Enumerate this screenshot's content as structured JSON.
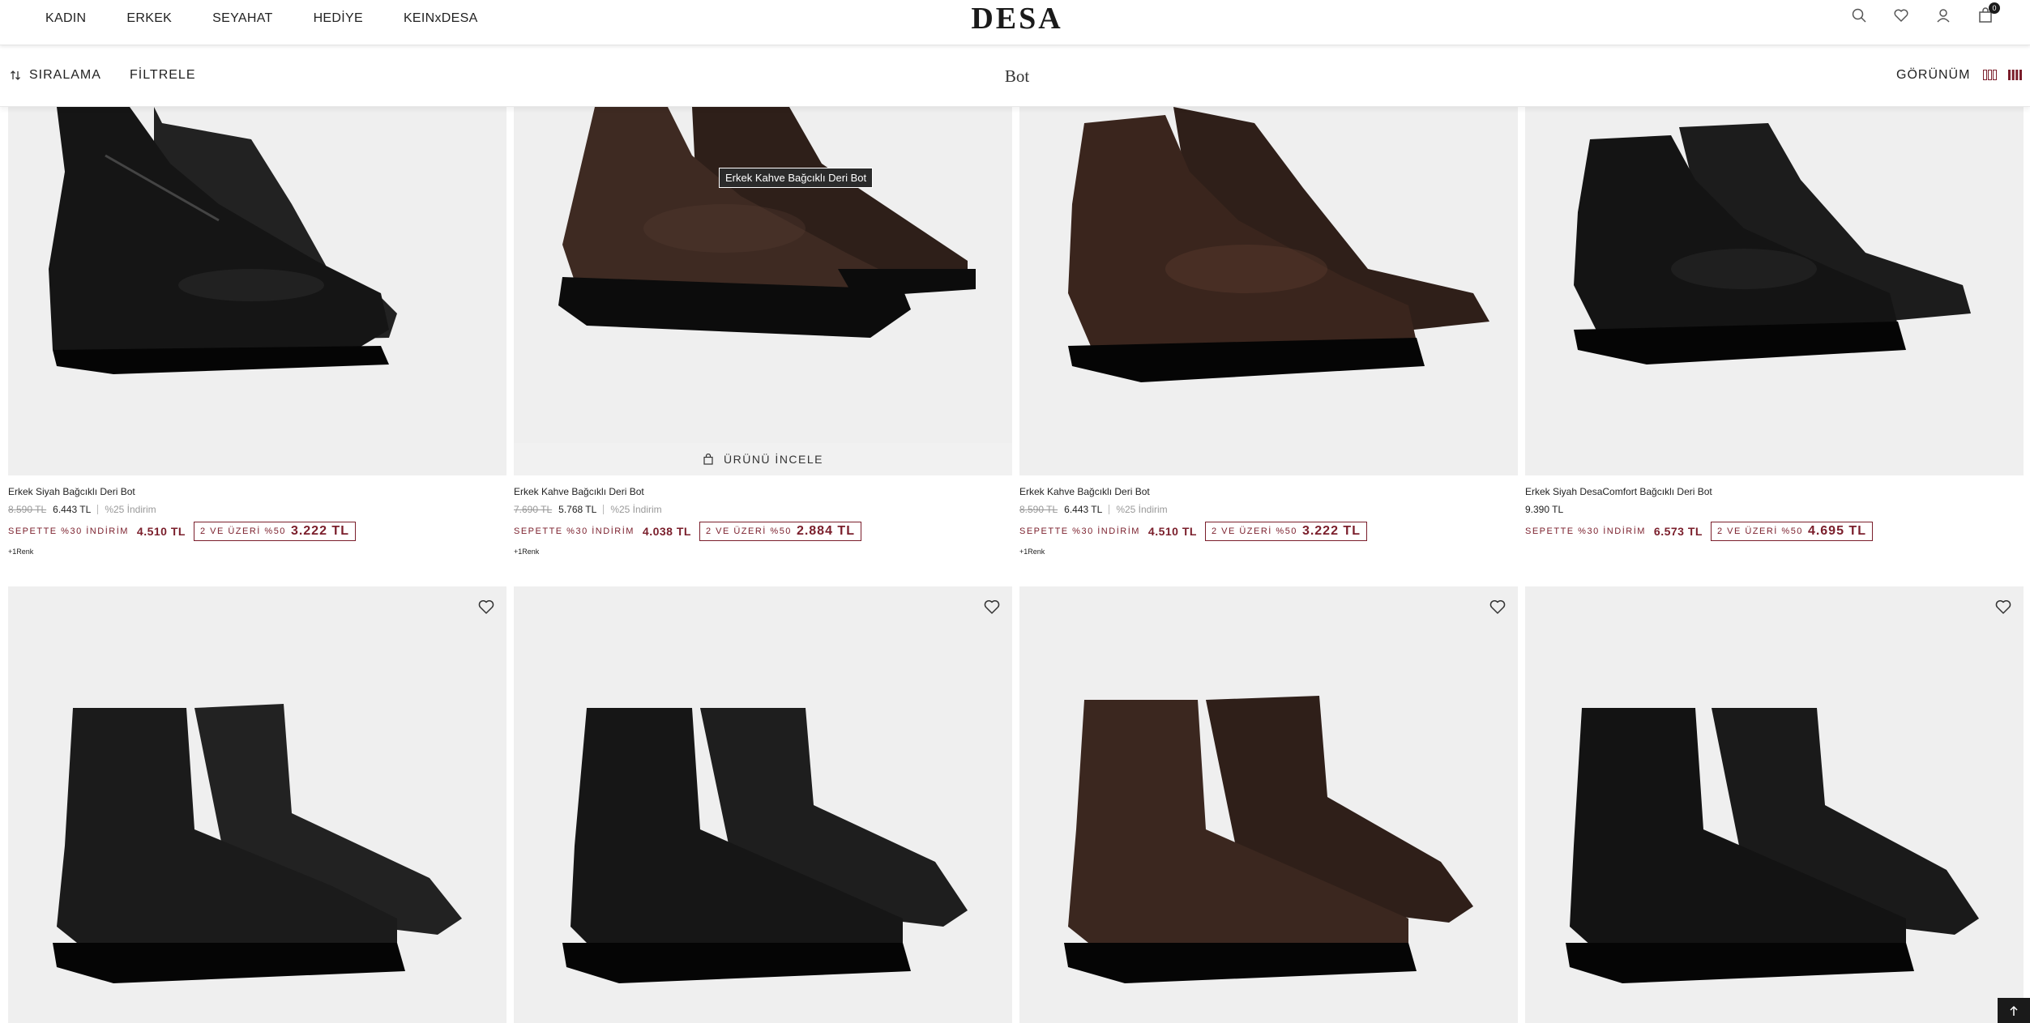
{
  "nav": {
    "links": [
      "KADIN",
      "ERKEK",
      "SEYAHAT",
      "HEDİYE",
      "KEINxDESA"
    ],
    "logo": "DESA",
    "icons": [
      "search-icon",
      "heart-icon",
      "user-icon",
      "bag-icon"
    ],
    "cart_count": "0"
  },
  "toolbar": {
    "sort_label": "SIRALAMA",
    "filter_label": "FİLTRELE",
    "page_title": "Bot",
    "view_label": "GÖRÜNÜM"
  },
  "colors": {
    "accent": "#7a1e2b",
    "text": "#222222",
    "image_bg": "#efefef"
  },
  "hover": {
    "tooltip": "Erkek Kahve Bağcıklı Deri Bot",
    "inspect_label": "ÜRÜNÜ İNCELE"
  },
  "products": [
    {
      "name": "Erkek Siyah Bağcıklı Deri Bot",
      "old_price": "8.590 TL",
      "price": "6.443 TL",
      "discount": "%25 İndirim",
      "cart_label": "SEPETTE %30 İNDİRİM",
      "cart_price": "4.510 TL",
      "multi_label": "2 VE ÜZERİ %50",
      "multi_price": "3.222 TL",
      "colors_note": "+1Renk",
      "shoe_color": "#151515"
    },
    {
      "name": "Erkek Kahve Bağcıklı Deri Bot",
      "old_price": "7.690 TL",
      "price": "5.768 TL",
      "discount": "%25 İndirim",
      "cart_label": "SEPETTE %30 İNDİRİM",
      "cart_price": "4.038 TL",
      "multi_label": "2 VE ÜZERİ %50",
      "multi_price": "2.884 TL",
      "colors_note": "+1Renk",
      "shoe_color": "#3e2a22"
    },
    {
      "name": "Erkek Kahve Bağcıklı Deri Bot",
      "old_price": "8.590 TL",
      "price": "6.443 TL",
      "discount": "%25 İndirim",
      "cart_label": "SEPETTE %30 İNDİRİM",
      "cart_price": "4.510 TL",
      "multi_label": "2 VE ÜZERİ %50",
      "multi_price": "3.222 TL",
      "colors_note": "+1Renk",
      "shoe_color": "#3a251d"
    },
    {
      "name": "Erkek Siyah DesaComfort Bağcıklı Deri Bot",
      "price": "9.390 TL",
      "cart_label": "SEPETTE %30 İNDİRİM",
      "cart_price": "6.573 TL",
      "multi_label": "2 VE ÜZERİ %50",
      "multi_price": "4.695 TL",
      "shoe_color": "#141414"
    }
  ],
  "products_row2": [
    {
      "shoe_color": "#1b1b1b"
    },
    {
      "shoe_color": "#161616"
    },
    {
      "shoe_color": "#3b271f"
    },
    {
      "shoe_color": "#131313"
    }
  ]
}
